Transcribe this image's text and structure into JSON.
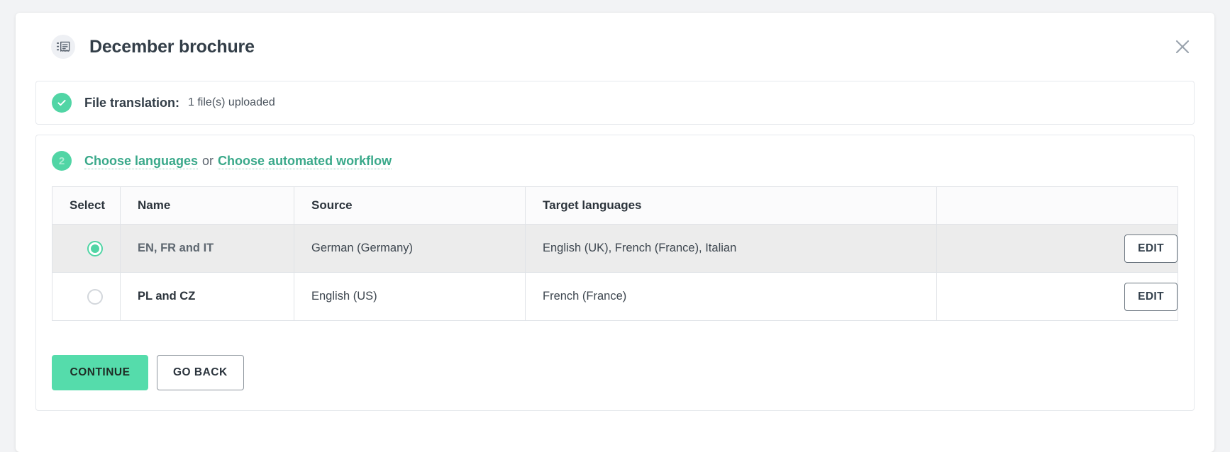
{
  "modal": {
    "title": "December brochure",
    "title_icon": "document-lines-icon",
    "close_icon": "close-icon"
  },
  "steps": {
    "step1": {
      "status_icon": "check-icon",
      "label": "File translation:",
      "value": "1 file(s) uploaded"
    },
    "step2": {
      "badge": "2",
      "link_primary": "Choose languages",
      "conjunction": "or",
      "link_secondary": "Choose automated workflow"
    }
  },
  "table": {
    "headers": [
      "Select",
      "Name",
      "Source",
      "Target languages",
      ""
    ],
    "rows": [
      {
        "selected": true,
        "name": "EN, FR and IT",
        "source": "German (Germany)",
        "target": "English (UK), French (France), Italian",
        "action": "EDIT"
      },
      {
        "selected": false,
        "name": "PL and CZ",
        "source": "English (US)",
        "target": "French (France)",
        "action": "EDIT"
      }
    ]
  },
  "footer": {
    "continue_label": "CONTINUE",
    "go_back_label": "GO BACK"
  },
  "colors": {
    "accent_green": "#51d5a5",
    "primary_button": "#55dcab",
    "link_green": "#3aa98a",
    "selected_row": "#ececec",
    "text_dark": "#333e48"
  }
}
